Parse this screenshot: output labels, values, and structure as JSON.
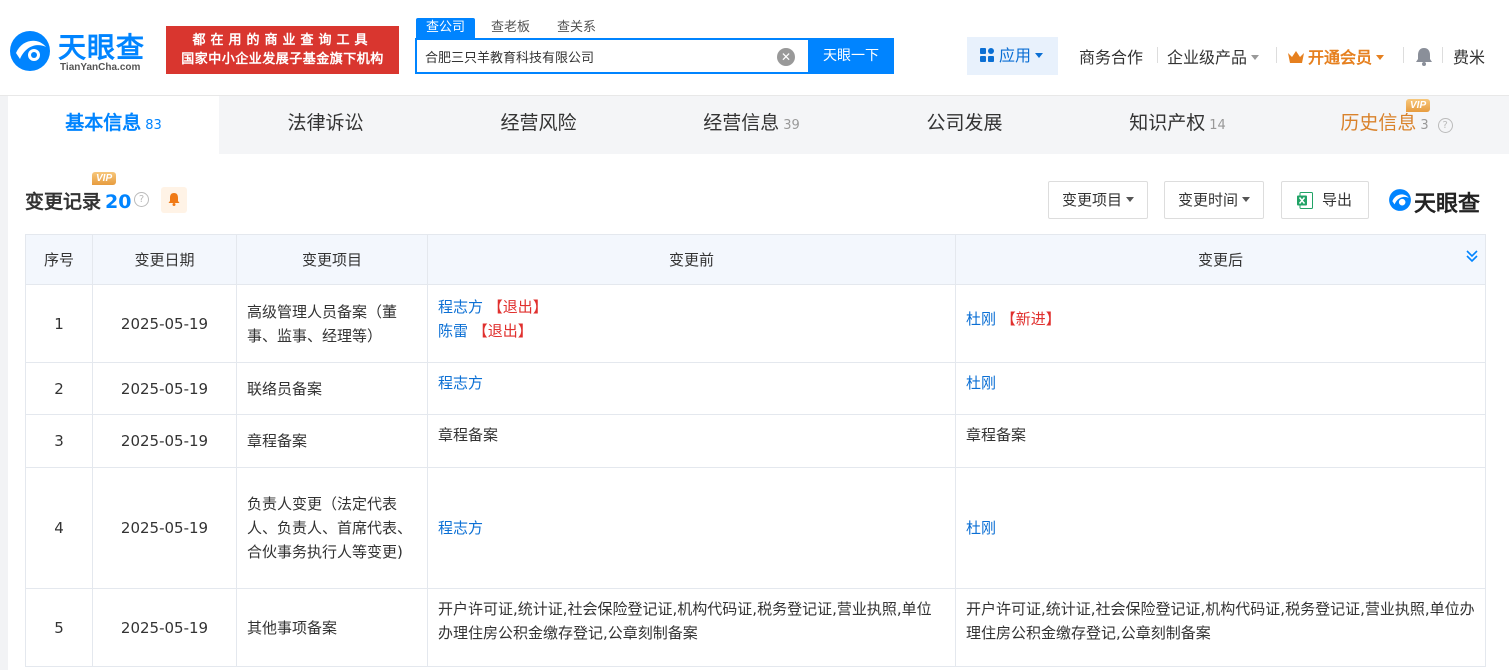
{
  "header": {
    "logo_name": "天眼查",
    "logo_pinyin": "TianYanCha.com",
    "slogan_line1": "都在用的商业查询工具",
    "slogan_line2": "国家中小企业发展子基金旗下机构",
    "search_tabs": [
      "查公司",
      "查老板",
      "查关系"
    ],
    "search_value": "合肥三只羊教育科技有限公司",
    "search_button": "天眼一下",
    "app_label": "应用",
    "nav": [
      "商务合作",
      "企业级产品",
      "开通会员",
      "费米"
    ],
    "brand_color": "#0084ff"
  },
  "tabs": [
    {
      "label": "基本信息",
      "count": "83"
    },
    {
      "label": "法律诉讼",
      "count": ""
    },
    {
      "label": "经营风险",
      "count": ""
    },
    {
      "label": "经营信息",
      "count": "39"
    },
    {
      "label": "公司发展",
      "count": ""
    },
    {
      "label": "知识产权",
      "count": "14"
    },
    {
      "label": "历史信息",
      "count": "3"
    }
  ],
  "vip_tag": "VIP",
  "section": {
    "title": "变更记录",
    "count": "20",
    "filter_item": "变更项目",
    "filter_time": "变更时间",
    "export_label": "导出",
    "watermark": "天眼查"
  },
  "table": {
    "headers": [
      "序号",
      "变更日期",
      "变更项目",
      "变更前",
      "变更后"
    ],
    "rows": [
      {
        "no": "1",
        "date": "2025-05-19",
        "item": "高级管理人员备案（董事、监事、经理等）",
        "before": [
          {
            "name": "程志方",
            "tag": "【退出】"
          },
          {
            "name": "陈雷",
            "tag": "【退出】"
          }
        ],
        "after": [
          {
            "name": "杜刚",
            "tag": "【新进】"
          }
        ]
      },
      {
        "no": "2",
        "date": "2025-05-19",
        "item": "联络员备案",
        "before": "程志方",
        "after": "杜刚"
      },
      {
        "no": "3",
        "date": "2025-05-19",
        "item": "章程备案",
        "before": "章程备案",
        "after": "章程备案"
      },
      {
        "no": "4",
        "date": "2025-05-19",
        "item": "负责人变更（法定代表人、负责人、首席代表、合伙事务执行人等变更)",
        "before": "程志方",
        "after": "杜刚"
      },
      {
        "no": "5",
        "date": "2025-05-19",
        "item": "其他事项备案",
        "before": "开户许可证,统计证,社会保险登记证,机构代码证,税务登记证,营业执照,单位办理住房公积金缴存登记,公章刻制备案",
        "after": "开户许可证,统计证,社会保险登记证,机构代码证,税务登记证,营业执照,单位办理住房公积金缴存登记,公章刻制备案"
      }
    ]
  }
}
